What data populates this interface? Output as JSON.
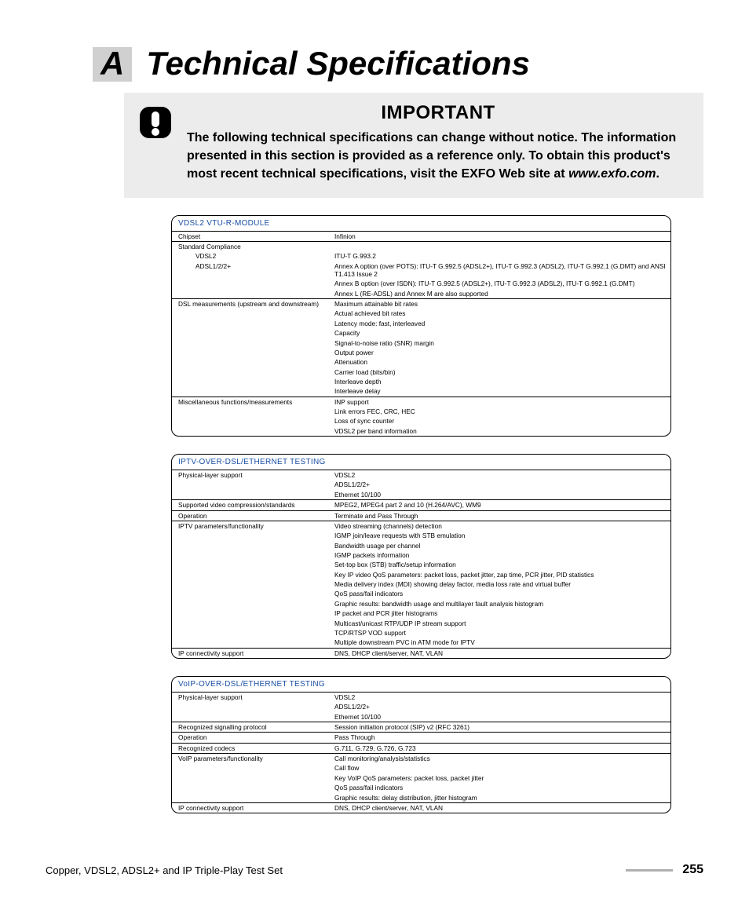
{
  "appendix": {
    "letter": "A",
    "title": "Technical Specifications"
  },
  "callout": {
    "heading": "IMPORTANT",
    "text_pre": "The following technical specifications can change without notice. The information presented in this section is provided as a reference only. To obtain this product's most recent technical specifications, visit the EXFO Web site at ",
    "text_em": "www.exfo.com",
    "text_post": "."
  },
  "blocks": [
    {
      "title": "VDSL2 VTU-R-MODULE",
      "rows": [
        {
          "g": true,
          "l": "Chipset",
          "v": "Infinion"
        },
        {
          "g": true,
          "l": "Standard Compliance",
          "v": ""
        },
        {
          "g": false,
          "l": "VDSL2",
          "indent": true,
          "v": "ITU-T G.993.2"
        },
        {
          "g": false,
          "l": "ADSL1/2/2+",
          "indent": true,
          "v": "Annex A option (over POTS): ITU-T G.992.5 (ADSL2+), ITU-T G.992.3 (ADSL2), ITU-T G.992.1 (G.DMT) and ANSI T1.413 Issue 2"
        },
        {
          "g": false,
          "l": "",
          "v": "Annex B option (over ISDN): ITU-T G.992.5 (ADSL2+), ITU-T G.992.3 (ADSL2), ITU-T G.992.1 (G.DMT)"
        },
        {
          "g": false,
          "l": "",
          "v": "Annex L (RE-ADSL) and Annex M are also supported"
        },
        {
          "g": true,
          "l": "DSL measurements (upstream and downstream)",
          "v": "Maximum attainable bit rates"
        },
        {
          "g": false,
          "l": "",
          "v": "Actual achieved bit rates"
        },
        {
          "g": false,
          "l": "",
          "v": "Latency mode: fast, interleaved"
        },
        {
          "g": false,
          "l": "",
          "v": "Capacity"
        },
        {
          "g": false,
          "l": "",
          "v": "Signal-to-noise ratio (SNR) margin"
        },
        {
          "g": false,
          "l": "",
          "v": "Output power"
        },
        {
          "g": false,
          "l": "",
          "v": "Attenuation"
        },
        {
          "g": false,
          "l": "",
          "v": "Carrier load (bits/bin)"
        },
        {
          "g": false,
          "l": "",
          "v": "Interleave depth"
        },
        {
          "g": false,
          "l": "",
          "v": "Interleave delay"
        },
        {
          "g": true,
          "l": "Miscellaneous functions/measurements",
          "v": "INP support"
        },
        {
          "g": false,
          "l": "",
          "v": "Link errors FEC, CRC, HEC"
        },
        {
          "g": false,
          "l": "",
          "v": "Loss of sync counter"
        },
        {
          "g": false,
          "l": "",
          "v": "VDSL2 per band information"
        }
      ]
    },
    {
      "title": "IPTV-OVER-DSL/ETHERNET TESTING",
      "rows": [
        {
          "g": true,
          "l": "Physical-layer support",
          "v": "VDSL2"
        },
        {
          "g": false,
          "l": "",
          "v": "ADSL1/2/2+"
        },
        {
          "g": false,
          "l": "",
          "v": "Ethernet 10/100"
        },
        {
          "g": true,
          "l": "Supported video compression/standards",
          "v": "MPEG2, MPEG4 part 2 and 10 (H.264/AVC), WM9"
        },
        {
          "g": true,
          "l": "Operation",
          "v": "Terminate and Pass Through"
        },
        {
          "g": true,
          "l": "IPTV parameters/functionality",
          "v": "Video streaming (channels) detection"
        },
        {
          "g": false,
          "l": "",
          "v": "IGMP join/leave requests with STB emulation"
        },
        {
          "g": false,
          "l": "",
          "v": "Bandwidth usage per channel"
        },
        {
          "g": false,
          "l": "",
          "v": "IGMP packets information"
        },
        {
          "g": false,
          "l": "",
          "v": "Set-top box (STB) traffic/setup information"
        },
        {
          "g": false,
          "l": "",
          "v": "Key IP video QoS parameters: packet loss, packet jitter, zap time, PCR jitter, PID statistics"
        },
        {
          "g": false,
          "l": "",
          "v": "Media delivery index (MDI) showing delay factor, media loss rate and virtual buffer"
        },
        {
          "g": false,
          "l": "",
          "v": "QoS pass/fail indicators"
        },
        {
          "g": false,
          "l": "",
          "v": "Graphic results: bandwidth usage and multilayer fault analysis histogram"
        },
        {
          "g": false,
          "l": "",
          "v": "IP packet and PCR jitter histograms"
        },
        {
          "g": false,
          "l": "",
          "v": "Multicast/unicast RTP/UDP IP stream support"
        },
        {
          "g": false,
          "l": "",
          "v": "TCP/RTSP VOD support"
        },
        {
          "g": false,
          "l": "",
          "v": "Multiple downstream PVC in ATM mode for IPTV"
        },
        {
          "g": true,
          "l": "IP connectivity support",
          "v": "DNS, DHCP client/server, NAT, VLAN"
        }
      ]
    },
    {
      "title": "VoIP-OVER-DSL/ETHERNET TESTING",
      "rows": [
        {
          "g": true,
          "l": "Physical-layer support",
          "v": "VDSL2"
        },
        {
          "g": false,
          "l": "",
          "v": "ADSL1/2/2+"
        },
        {
          "g": false,
          "l": "",
          "v": "Ethernet 10/100"
        },
        {
          "g": true,
          "l": "Recognized signalling protocol",
          "v": "Session initiation protocol (SIP) v2 (RFC 3261)"
        },
        {
          "g": true,
          "l": "Operation",
          "v": "Pass Through"
        },
        {
          "g": true,
          "l": "Recognized codecs",
          "v": "G.711, G.729, G.726, G.723"
        },
        {
          "g": true,
          "l": "VoIP parameters/functionality",
          "v": "Call monitoring/analysis/statistics"
        },
        {
          "g": false,
          "l": "",
          "v": "Call flow"
        },
        {
          "g": false,
          "l": "",
          "v": "Key VoIP QoS parameters: packet loss, packet jitter"
        },
        {
          "g": false,
          "l": "",
          "v": "QoS pass/fail indicators"
        },
        {
          "g": false,
          "l": "",
          "v": "Graphic results: delay distribution, jitter histogram"
        },
        {
          "g": true,
          "l": "IP connectivity support",
          "v": "DNS, DHCP client/server, NAT, VLAN"
        }
      ]
    }
  ],
  "footer": {
    "left": "Copper, VDSL2, ADSL2+ and IP Triple-Play Test Set",
    "page": "255"
  }
}
